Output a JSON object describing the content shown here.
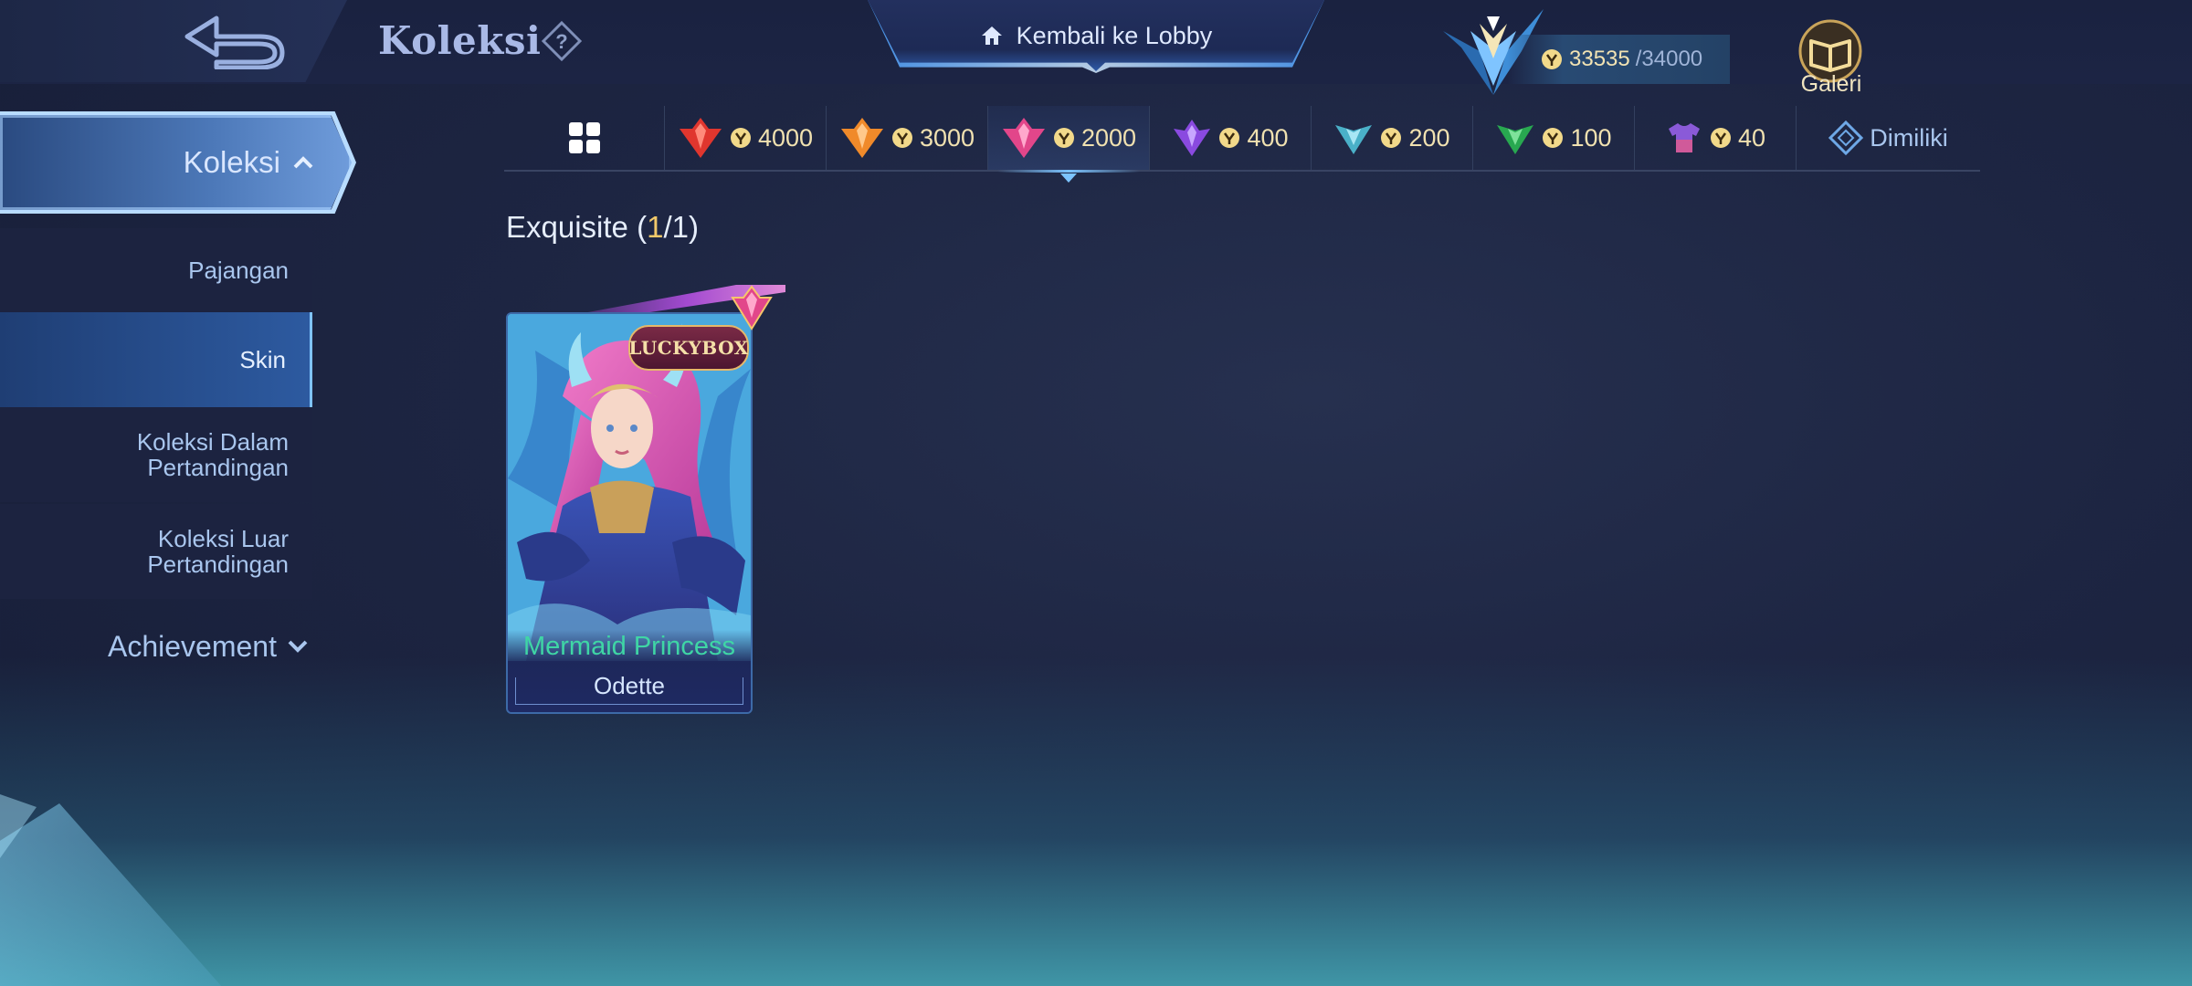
{
  "header": {
    "title": "Koleksi",
    "lobby_label": "Kembali ke Lobby",
    "points_current": "33535",
    "points_max": "/34000",
    "gallery_label": "Galeri"
  },
  "sidebar": {
    "main_label": "Koleksi",
    "items": [
      {
        "label": "Pajangan"
      },
      {
        "label": "Skin"
      },
      {
        "label_line1": "Koleksi Dalam",
        "label_line2": "Pertandingan"
      },
      {
        "label_line1": "Koleksi Luar",
        "label_line2": "Pertandingan"
      }
    ],
    "achievement_label": "Achievement"
  },
  "tabs": [
    {
      "icon": "grid-icon",
      "value": ""
    },
    {
      "icon": "red-gem-icon",
      "value": "4000",
      "color": "#e0362e"
    },
    {
      "icon": "orange-gem-icon",
      "value": "3000",
      "color": "#f08a2a"
    },
    {
      "icon": "pink-gem-icon",
      "value": "2000",
      "color": "#e2468a"
    },
    {
      "icon": "purple-gem-icon",
      "value": "400",
      "color": "#8a4ae0"
    },
    {
      "icon": "teal-gem-icon",
      "value": "200",
      "color": "#4ab0c8"
    },
    {
      "icon": "green-gem-icon",
      "value": "100",
      "color": "#28a850"
    },
    {
      "icon": "shirt-icon",
      "value": "40"
    },
    {
      "icon": "diamond-outline-icon",
      "value": "Dimiliki"
    }
  ],
  "active_tab": "2000",
  "section": {
    "name": "Exquisite",
    "open": " (",
    "owned": "1",
    "total": "/1)"
  },
  "card": {
    "badge": "LUCKYBOX",
    "skin_name": "Mermaid Princess",
    "hero_name": "Odette"
  },
  "colors": {
    "accent_blue": "#7cc4ff",
    "skin_name_green": "#3fd6a5",
    "gold": "#f2c96a"
  }
}
